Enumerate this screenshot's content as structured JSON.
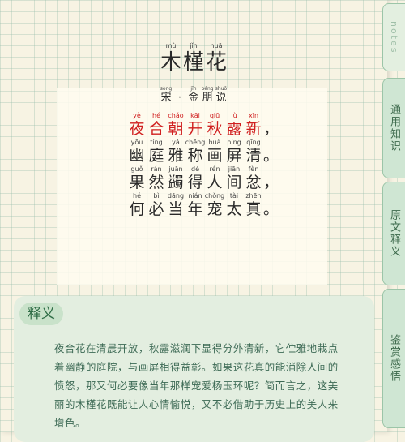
{
  "title": {
    "chars": [
      {
        "pinyin": "mù",
        "char": "木"
      },
      {
        "pinyin": "jǐn",
        "char": "槿"
      },
      {
        "pinyin": "huā",
        "char": "花"
      }
    ]
  },
  "author": {
    "chars": [
      {
        "pinyin": "sòng",
        "char": "宋"
      },
      {
        "pinyin": "",
        "char": "·"
      },
      {
        "pinyin": "jīn",
        "char": "金"
      },
      {
        "pinyin": "péng",
        "char": "朋"
      },
      {
        "pinyin": "shuō",
        "char": "说"
      }
    ]
  },
  "poem": {
    "highlight_color": "#d02020",
    "lines": [
      {
        "chars": [
          {
            "pinyin": "yè",
            "char": "夜"
          },
          {
            "pinyin": "hé",
            "char": "合"
          },
          {
            "pinyin": "cháo",
            "char": "朝"
          },
          {
            "pinyin": "kāi",
            "char": "开"
          },
          {
            "pinyin": "qiū",
            "char": "秋"
          },
          {
            "pinyin": "lù",
            "char": "露"
          },
          {
            "pinyin": "xīn",
            "char": "新"
          }
        ],
        "punct": "，"
      },
      {
        "chars": [
          {
            "pinyin": "yōu",
            "char": "幽"
          },
          {
            "pinyin": "tíng",
            "char": "庭"
          },
          {
            "pinyin": "yǎ",
            "char": "雅"
          },
          {
            "pinyin": "chēng",
            "char": "称"
          },
          {
            "pinyin": "huà",
            "char": "画"
          },
          {
            "pinyin": "píng",
            "char": "屏"
          },
          {
            "pinyin": "qīng",
            "char": "清"
          }
        ],
        "punct": "。"
      },
      {
        "chars": [
          {
            "pinyin": "guǒ",
            "char": "果"
          },
          {
            "pinyin": "rán",
            "char": "然"
          },
          {
            "pinyin": "juān",
            "char": "蠲"
          },
          {
            "pinyin": "dé",
            "char": "得"
          },
          {
            "pinyin": "rén",
            "char": "人"
          },
          {
            "pinyin": "jiān",
            "char": "间"
          },
          {
            "pinyin": "fèn",
            "char": "忿"
          }
        ],
        "punct": "，"
      },
      {
        "chars": [
          {
            "pinyin": "hé",
            "char": "何"
          },
          {
            "pinyin": "bì",
            "char": "必"
          },
          {
            "pinyin": "dāng",
            "char": "当"
          },
          {
            "pinyin": "nián",
            "char": "年"
          },
          {
            "pinyin": "chǒng",
            "char": "宠"
          },
          {
            "pinyin": "tài",
            "char": "太"
          },
          {
            "pinyin": "zhēn",
            "char": "真"
          }
        ],
        "punct": "。"
      }
    ]
  },
  "tabs": {
    "notes": "notes",
    "items": [
      "通用知识",
      "原文释义",
      "鉴赏感悟"
    ]
  },
  "explanation": {
    "heading": "释义",
    "text": "夜合花在清晨开放，秋露滋润下显得分外清新，它伫雅地栽点着幽静的庭院，与画屏相得益彰。如果这花真的能消除人间的愤怒，那又何必要像当年那样宠爱杨玉环呢？简而言之，这美丽的木槿花既能让人心情愉悦，又不必借助于历史上的美人来增色。"
  }
}
